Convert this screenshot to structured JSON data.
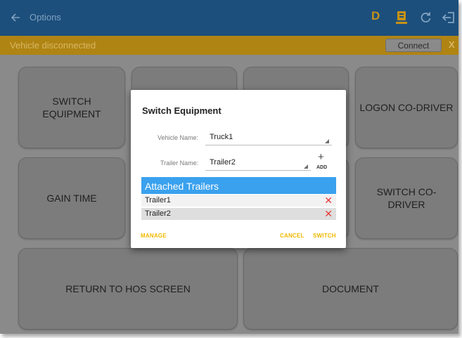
{
  "appbar": {
    "title": "Options",
    "back_icon": "arrow-left-icon",
    "duty_status": "D",
    "icons": [
      "document-icon",
      "refresh-icon",
      "logout-icon"
    ]
  },
  "banner": {
    "message": "Vehicle disconnected",
    "connect_label": "Connect",
    "close_label": "X"
  },
  "tiles": {
    "switch_equipment": "SWITCH EQUIPMENT",
    "logon_codriver": "LOGON CO-DRIVER",
    "gain_time": "GAIN TIME",
    "switch_codriver": "SWITCH CO-DRIVER",
    "return_hos": "RETURN TO HOS SCREEN",
    "document": "DOCUMENT"
  },
  "dialog": {
    "title": "Switch Equipment",
    "vehicle_label": "Vehicle Name:",
    "vehicle_value": "Truck1",
    "trailer_label": "Trailer Name:",
    "trailer_value": "Trailer2",
    "add_icon": "+",
    "add_label": "ADD",
    "attached_header": "Attached Trailers",
    "attached_trailers": [
      "Trailer1",
      "Trailer2"
    ],
    "remove_icon": "✕",
    "manage_label": "MANAGE",
    "cancel_label": "CANCEL",
    "switch_label": "SWITCH"
  },
  "colors": {
    "appbar": "#1d4f7c",
    "banner": "#b08413",
    "accent": "#3aa1ee",
    "action": "#f0b800",
    "remove": "#e53935"
  }
}
